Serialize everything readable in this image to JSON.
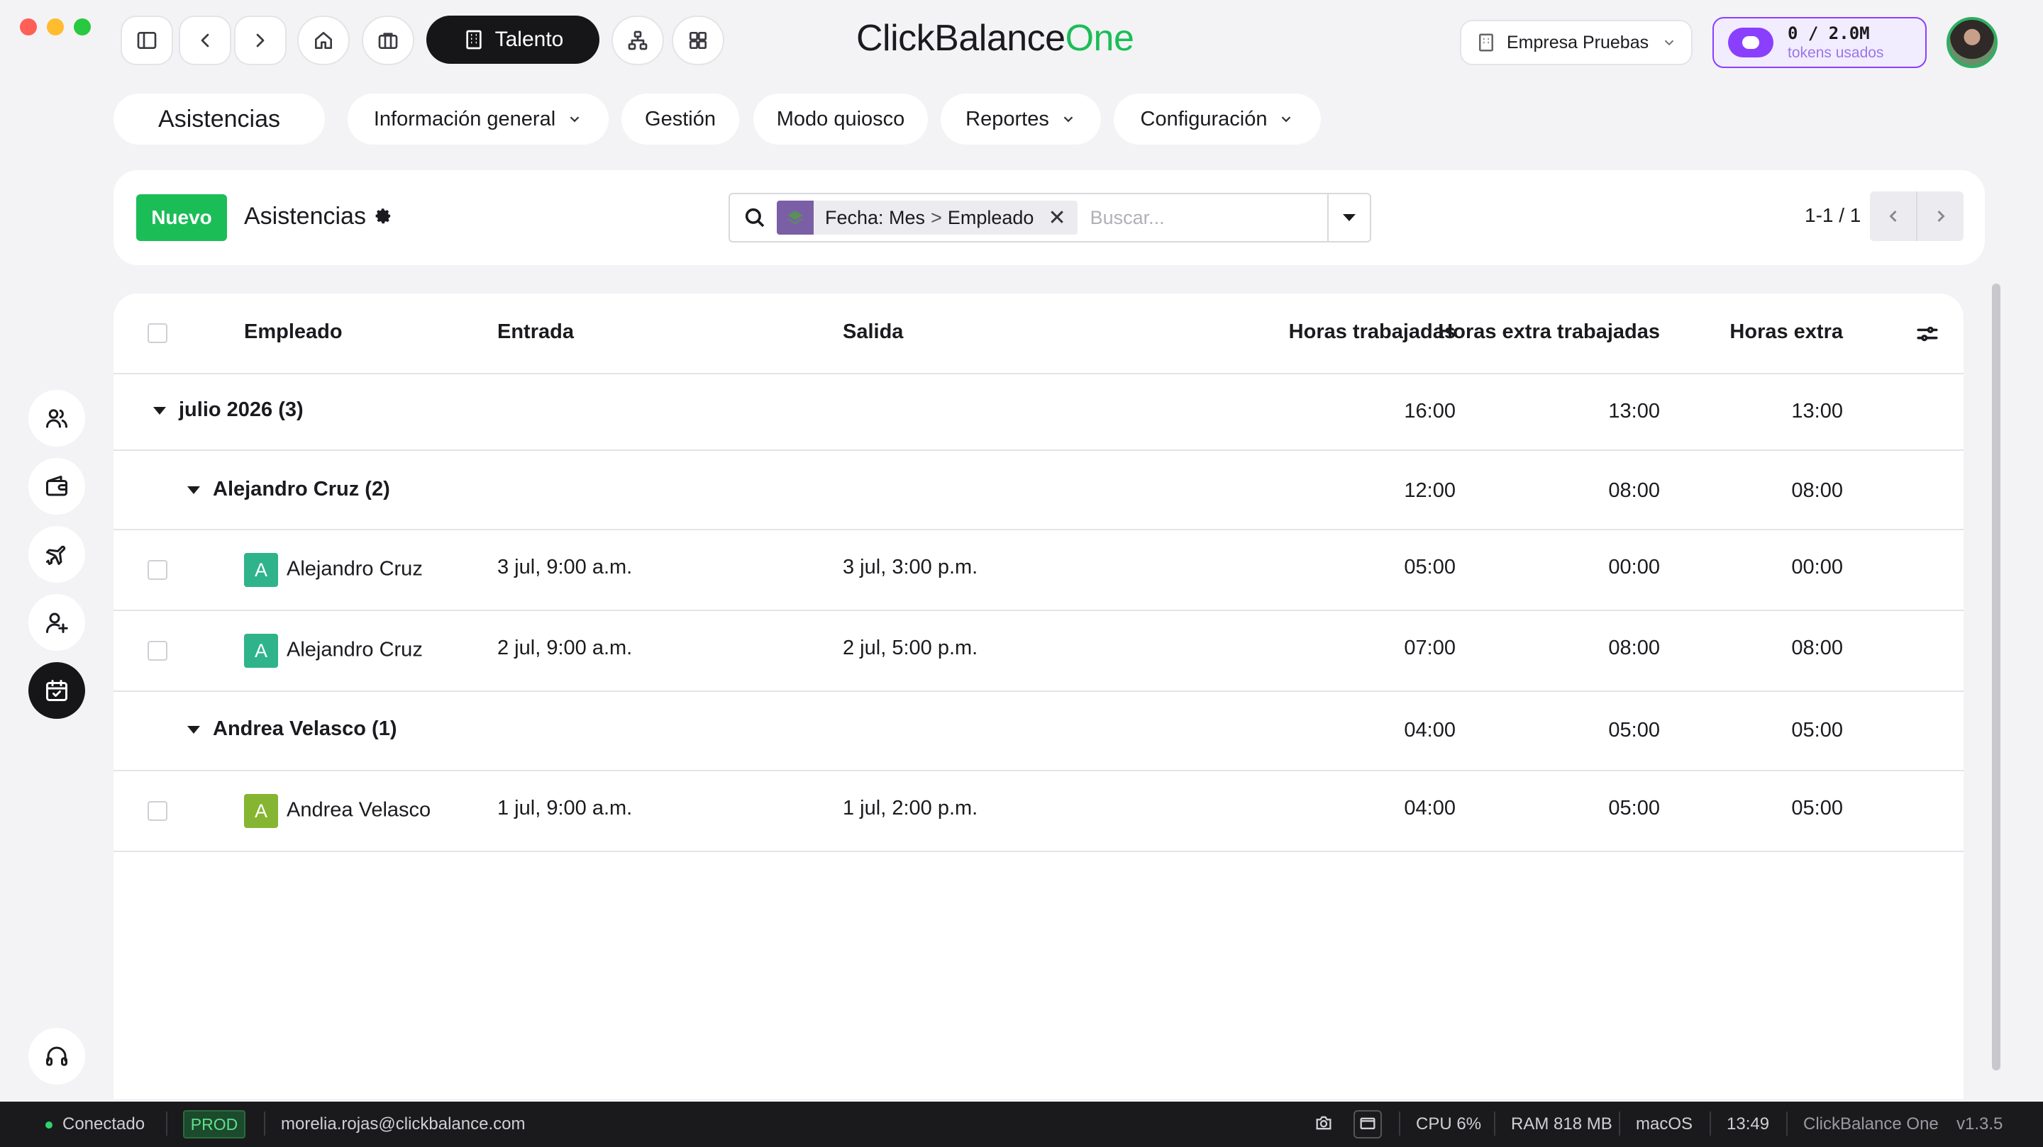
{
  "toolbar": {
    "module_label": "Talento",
    "brand_main": "ClickBalance",
    "brand_accent": "One",
    "company": "Empresa Pruebas",
    "tokens_value": "0 / 2.0M",
    "tokens_label": "tokens usados"
  },
  "nav": {
    "items": [
      {
        "label": "Asistencias",
        "active": true,
        "dropdown": false
      },
      {
        "label": "Información general",
        "dropdown": true
      },
      {
        "label": "Gestión",
        "dropdown": false
      },
      {
        "label": "Modo quiosco",
        "dropdown": false
      },
      {
        "label": "Reportes",
        "dropdown": true
      },
      {
        "label": "Configuración",
        "dropdown": true
      }
    ]
  },
  "control": {
    "new_label": "Nuevo",
    "title": "Asistencias",
    "facet_field": "Fecha: Mes",
    "facet_separator": ">",
    "facet_value": "Empleado",
    "search_placeholder": "Buscar...",
    "pager": "1-1 / 1"
  },
  "table": {
    "headers": {
      "employee": "Empleado",
      "entry": "Entrada",
      "exit": "Salida",
      "worked": "Horas trabajadas",
      "extra_worked": "Horas extra trabajadas",
      "extra": "Horas extra"
    },
    "groups": {
      "month": {
        "label": "julio 2026 (3)",
        "worked": "16:00",
        "extra_worked": "13:00",
        "extra": "13:00"
      },
      "alejandro": {
        "label": "Alejandro Cruz (2)",
        "worked": "12:00",
        "extra_worked": "08:00",
        "extra": "08:00"
      },
      "andrea": {
        "label": "Andrea Velasco (1)",
        "worked": "04:00",
        "extra_worked": "05:00",
        "extra": "05:00"
      }
    },
    "rows": [
      {
        "initial": "A",
        "name": "Alejandro Cruz",
        "entry": "3 jul, 9:00 a.m.",
        "exit": "3 jul, 3:00 p.m.",
        "worked": "05:00",
        "extra_worked": "00:00",
        "extra": "00:00",
        "color": "#2fb38a"
      },
      {
        "initial": "A",
        "name": "Alejandro Cruz",
        "entry": "2 jul, 9:00 a.m.",
        "exit": "2 jul, 5:00 p.m.",
        "worked": "07:00",
        "extra_worked": "08:00",
        "extra": "08:00",
        "color": "#2fb38a"
      },
      {
        "initial": "A",
        "name": "Andrea Velasco",
        "entry": "1 jul, 9:00 a.m.",
        "exit": "1 jul, 2:00 p.m.",
        "worked": "04:00",
        "extra_worked": "05:00",
        "extra": "05:00",
        "color": "#86b531"
      }
    ]
  },
  "status": {
    "connection": "Conectado",
    "env": "PROD",
    "email": "morelia.rojas@clickbalance.com",
    "cpu": "CPU 6%",
    "ram": "RAM 818 MB",
    "os": "macOS",
    "time": "13:49",
    "app": "ClickBalance One",
    "version": "v1.3.5"
  },
  "colors": {
    "accent_green": "#1bbd57",
    "token_purple": "#8a3fff"
  }
}
